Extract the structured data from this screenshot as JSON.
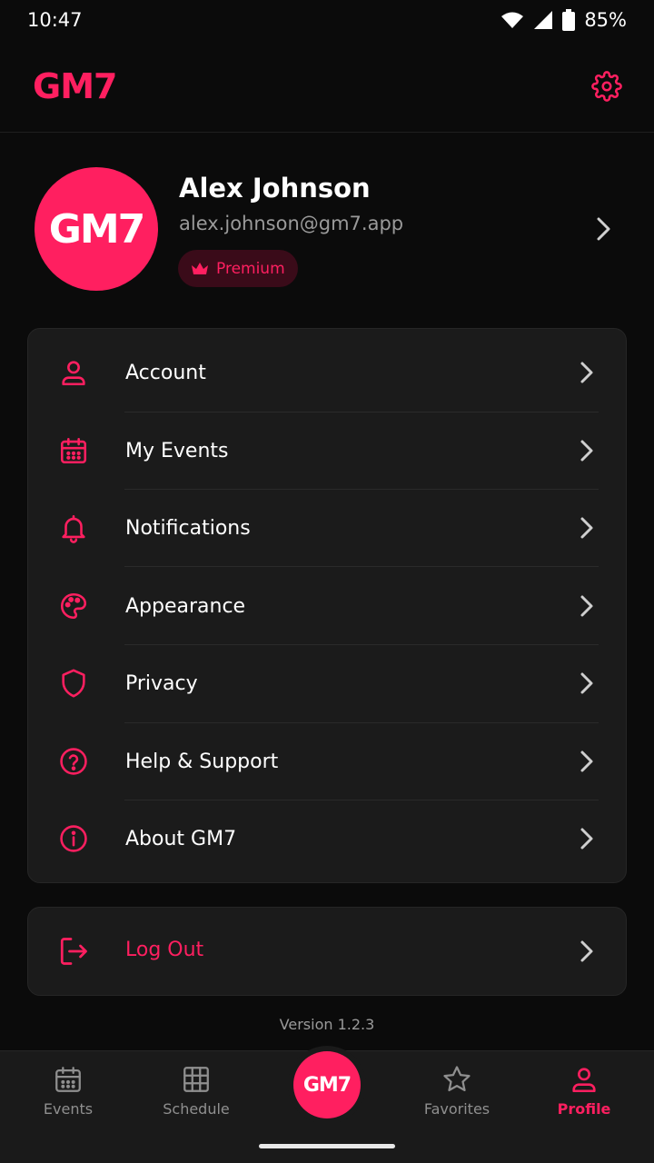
{
  "status_bar": {
    "time": "10:47",
    "battery": "85%"
  },
  "header": {
    "logo": "GM7",
    "settings_icon": "gear-icon"
  },
  "profile": {
    "avatar_text": "GM7",
    "name": "Alex Johnson",
    "email": "alex.johnson@gm7.app",
    "badge": "Premium"
  },
  "menu": {
    "items": [
      {
        "label": "Account",
        "icon": "user-icon"
      },
      {
        "label": "My Events",
        "icon": "calendar-icon"
      },
      {
        "label": "Notifications",
        "icon": "bell-icon"
      },
      {
        "label": "Appearance",
        "icon": "palette-icon"
      },
      {
        "label": "Privacy",
        "icon": "shield-icon"
      },
      {
        "label": "Help & Support",
        "icon": "help-circle-icon"
      },
      {
        "label": "About GM7",
        "icon": "info-icon"
      }
    ]
  },
  "logout": {
    "label": "Log Out",
    "icon": "logout-icon"
  },
  "version": "Version 1.2.3",
  "bottom_nav": {
    "items": [
      {
        "label": "Events",
        "icon": "calendar-icon"
      },
      {
        "label": "Schedule",
        "icon": "grid-icon"
      },
      {
        "label": "GM7"
      },
      {
        "label": "Favorites",
        "icon": "star-icon"
      },
      {
        "label": "Profile",
        "icon": "user-icon"
      }
    ],
    "active": "Profile"
  },
  "colors": {
    "accent": "#ff1f60",
    "background": "#0b0b0b",
    "card": "#1b1b1b"
  }
}
